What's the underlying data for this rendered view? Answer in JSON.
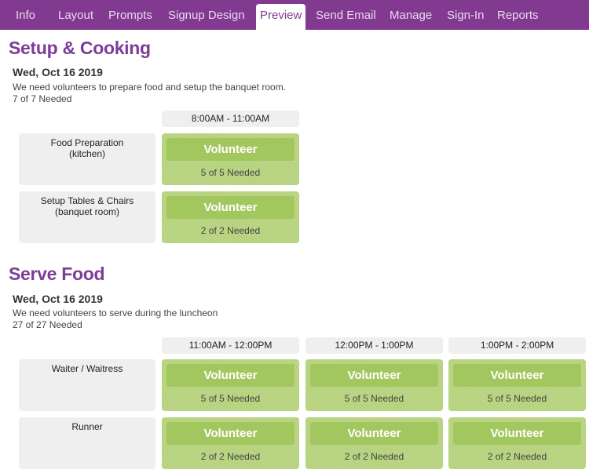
{
  "nav": {
    "tabs": [
      {
        "label": "Info",
        "active": false
      },
      {
        "label": "Layout",
        "active": false
      },
      {
        "label": "Prompts",
        "active": false
      },
      {
        "label": "Signup Design",
        "active": false
      },
      {
        "label": "Preview",
        "active": true
      },
      {
        "label": "Send Email",
        "active": false
      },
      {
        "label": "Manage",
        "active": false
      },
      {
        "label": "Sign-In",
        "active": false
      },
      {
        "label": "Reports",
        "active": false
      }
    ]
  },
  "colors": {
    "nav_bg": "#823a91",
    "title": "#7d3c98",
    "slot_bg": "#b4d17a",
    "button_bg": "#a3c75f",
    "cell_bg": "#efefef"
  },
  "sections": [
    {
      "title": "Setup & Cooking",
      "date": "Wed, Oct 16 2019",
      "description": "We need volunteers to prepare food and setup the banquet room.",
      "needed": "7 of 7 Needed",
      "time_slots": [
        "8:00AM - 11:00AM"
      ],
      "roles": [
        {
          "name": "Food Preparation\n(kitchen)",
          "line1": "Food Preparation",
          "line2": "(kitchen)",
          "slots": [
            {
              "button": "Volunteer",
              "needed": "5 of 5 Needed"
            }
          ]
        },
        {
          "name": "Setup Tables & Chairs\n(banquet room)",
          "line1": "Setup Tables & Chairs",
          "line2": "(banquet room)",
          "slots": [
            {
              "button": "Volunteer",
              "needed": "2 of 2 Needed"
            }
          ]
        }
      ]
    },
    {
      "title": "Serve Food",
      "date": "Wed, Oct 16 2019",
      "description": "We need volunteers to serve during the luncheon",
      "needed": "27 of 27 Needed",
      "time_slots": [
        "11:00AM - 12:00PM",
        "12:00PM - 1:00PM",
        "1:00PM - 2:00PM"
      ],
      "roles": [
        {
          "line1": "Waiter / Waitress",
          "line2": "",
          "slots": [
            {
              "button": "Volunteer",
              "needed": "5 of 5 Needed"
            },
            {
              "button": "Volunteer",
              "needed": "5 of 5 Needed"
            },
            {
              "button": "Volunteer",
              "needed": "5 of 5 Needed"
            }
          ]
        },
        {
          "line1": "Runner",
          "line2": "",
          "slots": [
            {
              "button": "Volunteer",
              "needed": "2 of 2 Needed"
            },
            {
              "button": "Volunteer",
              "needed": "2 of 2 Needed"
            },
            {
              "button": "Volunteer",
              "needed": "2 of 2 Needed"
            }
          ]
        }
      ]
    }
  ]
}
